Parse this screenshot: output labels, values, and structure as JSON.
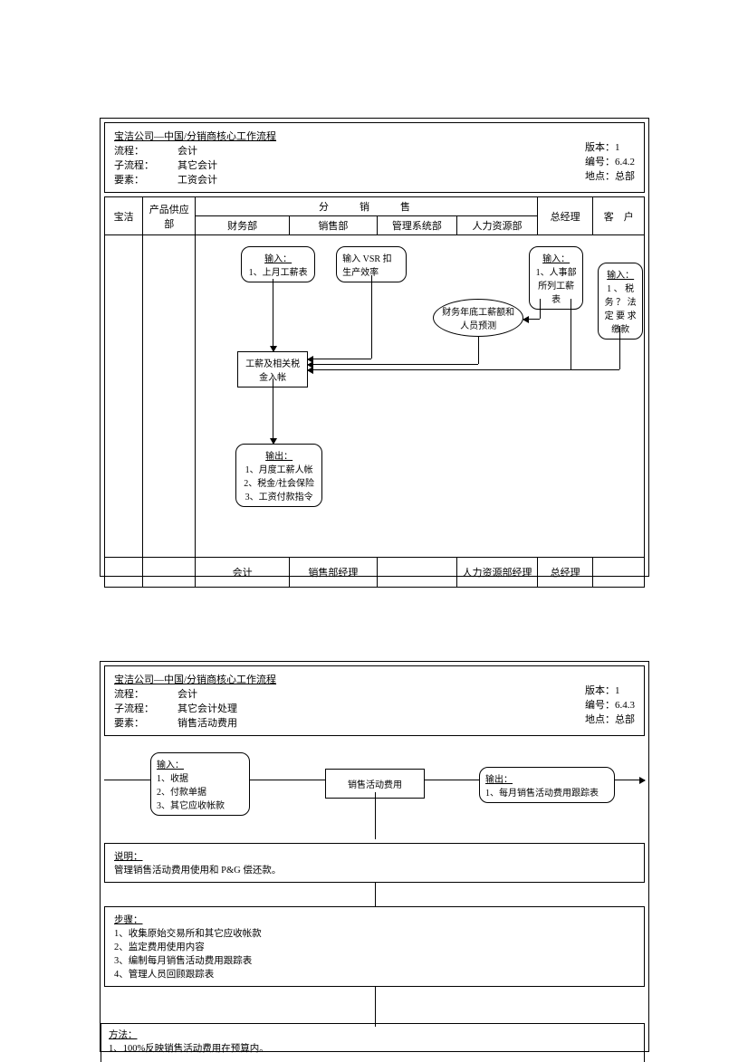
{
  "diagram1": {
    "header": {
      "title": "宝洁公司—中国/分销商核心工作流程",
      "row1_label": "流程：",
      "row1_value": "会计",
      "row2_label": "子流程：",
      "row2_value": "其它会计",
      "row3_label": "要素：",
      "row3_value": "工资会计",
      "version_label": "版本：",
      "version_value": "1",
      "code_label": "编号：",
      "code_value": "6.4.2",
      "loc_label": "地点：",
      "loc_value": "总部"
    },
    "cols": {
      "bj": "宝洁",
      "group_title": "分　　销　　售",
      "prod": "产品供应部",
      "fin": "财务部",
      "sales": "销售部",
      "mgmt": "管理系统部",
      "hr": "人力资源部",
      "gm": "总经理",
      "cust": "客　户"
    },
    "nodes": {
      "input1_title": "输入：",
      "input1_item1": "1、上月工薪表",
      "vsr": "输入 VSR 扣生产效率",
      "forecast": "财务年底工薪额和人员预测",
      "input_hr_title": "输入：",
      "input_hr_item1": "1、人事部所列工薪表",
      "input_cust_title": "输入：",
      "input_cust_item1": "1 、 税务 ？ 法定 要 求缴款",
      "process": "工薪及相关税金入帐",
      "output_title": "输出：",
      "output_item1": "1、月度工薪人帐",
      "output_item2": "2、税金/社会保险",
      "output_item3": "3、工资付款指令"
    },
    "footer": {
      "fin": "会计",
      "sales": "销售部经理",
      "hr": "人力资源部经理",
      "gm": "总经理"
    }
  },
  "diagram2": {
    "header": {
      "title": "宝洁公司—中国/分销商核心工作流程",
      "row1_label": "流程：",
      "row1_value": "会计",
      "row2_label": "子流程：",
      "row2_value": "其它会计处理",
      "row3_label": "要素：",
      "row3_value": "销售活动费用",
      "version_label": "版本：",
      "version_value": "1",
      "code_label": "编号：",
      "code_value": "6.4.3",
      "loc_label": "地点：",
      "loc_value": "总部"
    },
    "flow": {
      "input_title": "输入：",
      "input_item1": "1、收据",
      "input_item2": "2、付款单据",
      "input_item3": "3、其它应收帐款",
      "center": "销售活动费用",
      "output_title": "输出：",
      "output_item1": "1、每月销售活动费用跟踪表"
    },
    "explain_title": "说明：",
    "explain_body": "管理销售活动费用使用和 P&G 偿还款。",
    "steps_title": "步骤：",
    "steps_1": "1、收集原始交易所和其它应收帐款",
    "steps_2": "2、监定费用使用内容",
    "steps_3": "3、编制每月销售活动费用跟踪表",
    "steps_4": "4、管理人员回顾跟踪表",
    "method_title": "方法：",
    "method_1": "1、100%反映销售活动费用在预算内。"
  }
}
